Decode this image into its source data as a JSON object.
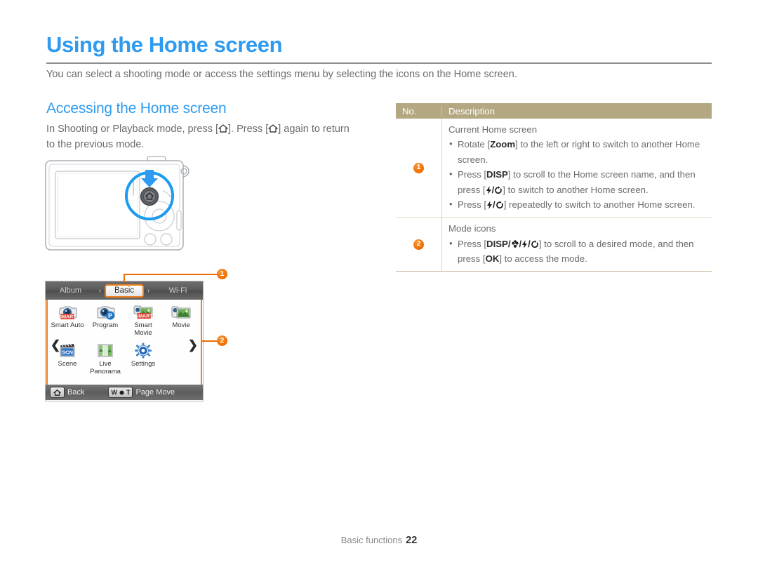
{
  "page": {
    "title": "Using the Home screen",
    "intro": "You can select a shooting mode or access the settings menu by selecting the icons on the Home screen.",
    "section_title": "Accessing the Home screen",
    "body_part1": "In Shooting or Playback mode, press [",
    "body_part2": "]. Press [",
    "body_part3": "] again to return to the previous mode.",
    "accent_color": "#2e9bf0",
    "callout_color": "#ef6c00",
    "table_header_color": "#b3a882"
  },
  "camera": {
    "highlight_button": "home-button",
    "arrow": "down-arrow"
  },
  "homescreen": {
    "tabs": {
      "left": "Album",
      "active": "Basic",
      "right": "Wi-Fi",
      "left_arrow": "‹",
      "right_arrow": "›"
    },
    "modes_row1": [
      {
        "label": "Smart Auto",
        "icon": "smart-auto-icon"
      },
      {
        "label": "Program",
        "icon": "program-icon"
      },
      {
        "label": "Smart Movie",
        "icon": "smart-movie-icon"
      },
      {
        "label": "Movie",
        "icon": "movie-icon"
      }
    ],
    "modes_row2": [
      {
        "label": "Scene",
        "icon": "scene-icon"
      },
      {
        "label": "Live Panorama",
        "icon": "live-panorama-icon"
      },
      {
        "label": "Settings",
        "icon": "settings-icon"
      }
    ],
    "page_left_arrow": "❮",
    "page_right_arrow": "❯",
    "bottom": {
      "back_label": "Back",
      "page_move_label": "Page Move",
      "zoom_w": "W",
      "zoom_t": "T"
    }
  },
  "callouts": {
    "one": "1",
    "two": "2"
  },
  "table": {
    "headers": {
      "no": "No.",
      "description": "Description"
    },
    "rows": [
      {
        "no": "1",
        "lead": "Current Home screen",
        "bullets": [
          {
            "seg": [
              {
                "t": "Rotate ["
              },
              {
                "t": "Zoom",
                "b": true
              },
              {
                "t": "] to the left or right to switch to another Home screen."
              }
            ]
          },
          {
            "seg": [
              {
                "t": "Press ["
              },
              {
                "t": "DISP",
                "b": true
              },
              {
                "t": "] to scroll to the Home screen name, and then press ["
              },
              {
                "t": "⚡/⏱",
                "b": true
              },
              {
                "t": "] to switch to another Home screen."
              }
            ]
          },
          {
            "seg": [
              {
                "t": "Press ["
              },
              {
                "t": "⚡/⏱",
                "b": true
              },
              {
                "t": "] repeatedly to switch to another Home screen."
              }
            ]
          }
        ]
      },
      {
        "no": "2",
        "lead": "Mode icons",
        "bullets": [
          {
            "seg": [
              {
                "t": "Press ["
              },
              {
                "t": "DISP/❁/⚡/⏱",
                "b": true
              },
              {
                "t": "] to scroll to a desired mode, and then press ["
              },
              {
                "t": "OK",
                "b": true
              },
              {
                "t": "] to access the mode."
              }
            ]
          }
        ]
      }
    ]
  },
  "footer": {
    "label": "Basic functions",
    "page_number": "22"
  }
}
